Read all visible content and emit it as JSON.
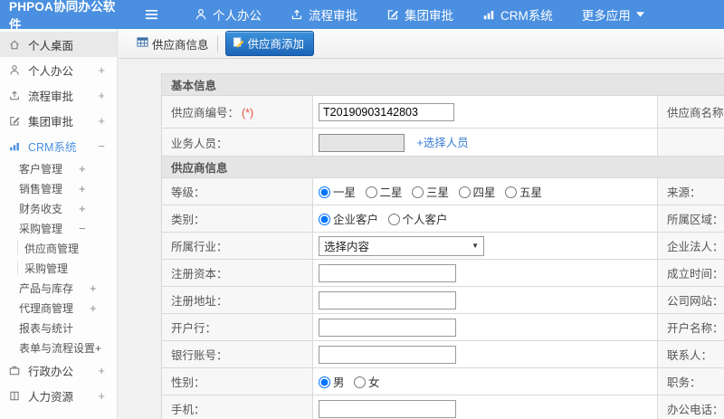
{
  "navbar": {
    "brand": "PHPOA协同办公软件",
    "items": [
      {
        "label": "个人办公",
        "icon": "person-icon"
      },
      {
        "label": "流程审批",
        "icon": "flow-icon"
      },
      {
        "label": "集团审批",
        "icon": "edit-icon"
      },
      {
        "label": "CRM系统",
        "icon": "chart-icon"
      },
      {
        "label": "更多应用",
        "icon": "caret-down-icon"
      }
    ]
  },
  "sidebar": {
    "items": [
      {
        "label": "个人桌面",
        "icon": "home-icon",
        "level": 1,
        "active": true,
        "expand": ""
      },
      {
        "label": "个人办公",
        "icon": "person-icon",
        "level": 1,
        "expand": "+"
      },
      {
        "label": "流程审批",
        "icon": "flow-icon",
        "level": 1,
        "expand": "+"
      },
      {
        "label": "集团审批",
        "icon": "edit-icon",
        "level": 1,
        "expand": "+"
      },
      {
        "label": "CRM系统",
        "icon": "chart-icon",
        "level": 1,
        "expand": "−",
        "highlight": true
      },
      {
        "label": "客户管理",
        "level": 2,
        "expand": "+"
      },
      {
        "label": "销售管理",
        "level": 2,
        "expand": "+"
      },
      {
        "label": "财务收支",
        "level": 2,
        "expand": "+"
      },
      {
        "label": "采购管理",
        "level": 2,
        "expand": "−"
      },
      {
        "label": "供应商管理",
        "level": 3
      },
      {
        "label": "采购管理",
        "level": 3
      },
      {
        "label": "产品与库存",
        "level": 2,
        "expand": "+"
      },
      {
        "label": "代理商管理",
        "level": 2,
        "expand": "+"
      },
      {
        "label": "报表与统计",
        "level": 2
      },
      {
        "label": "表单与流程设置+",
        "level": 2
      },
      {
        "label": "行政办公",
        "icon": "briefcase-icon",
        "level": 1,
        "expand": "+"
      },
      {
        "label": "人力资源",
        "icon": "book-icon",
        "level": 1,
        "expand": "+"
      }
    ]
  },
  "tabs": {
    "info_label": "供应商信息",
    "add_label": "供应商添加"
  },
  "form": {
    "section1": {
      "title": "基本信息",
      "rows": [
        {
          "label": "供应商编号：",
          "required": "(*)",
          "value": "T20190903142803",
          "label2": "供应商名称：",
          "required2": "(*)"
        },
        {
          "label": "业务人员：",
          "link": "+选择人员",
          "label2": ""
        }
      ]
    },
    "section2": {
      "title": "供应商信息",
      "rows": [
        {
          "label": "等级：",
          "options": [
            "一星",
            "二星",
            "三星",
            "四星",
            "五星"
          ],
          "checked": 0,
          "label2": "来源："
        },
        {
          "label": "类别：",
          "options": [
            "企业客户",
            "个人客户"
          ],
          "checked": 0,
          "label2": "所属区域："
        },
        {
          "label": "所属行业：",
          "select": "选择内容",
          "label2": "企业法人："
        },
        {
          "label": "注册资本：",
          "input": true,
          "label2": "成立时间："
        },
        {
          "label": "注册地址：",
          "input": true,
          "label2": "公司网站："
        },
        {
          "label": "开户行：",
          "input": true,
          "label2": "开户名称："
        },
        {
          "label": "银行账号：",
          "input": true,
          "label2": "联系人："
        },
        {
          "label": "性别：",
          "options": [
            "男",
            "女"
          ],
          "checked": 0,
          "label2": "职务："
        },
        {
          "label": "手机：",
          "input": true,
          "label2": "办公电话："
        }
      ]
    }
  },
  "colors": {
    "navbar_bg": "#4a8fe0",
    "accent_blue": "#4a90e2",
    "tab_button_gradient": [
      "#3d93dc",
      "#1c64b8"
    ],
    "required_red": "#e8503c",
    "section_header_bg": "#e5e5e5",
    "label_cell_bg": "#f7f7f7",
    "table_border": "#d8d8d8",
    "link_blue": "#3b7fd4"
  }
}
